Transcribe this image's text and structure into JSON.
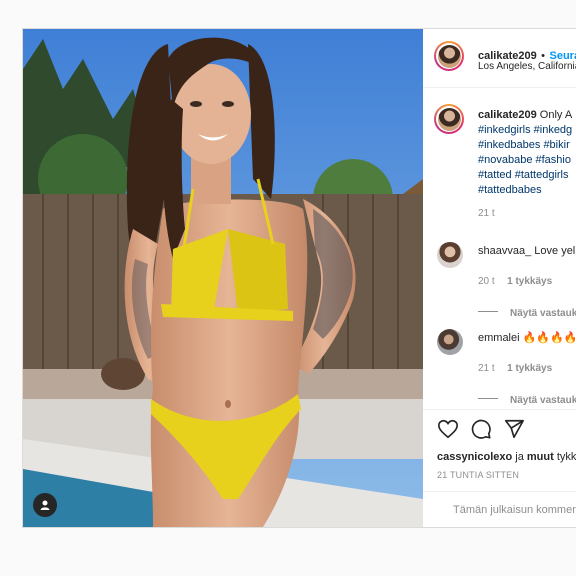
{
  "post": {
    "username": "calikate209",
    "separator": "•",
    "follow_label": "Seura",
    "location": "Los Angeles, California",
    "caption": {
      "username": "calikate209",
      "text": "Only A",
      "hashtags": [
        "#inkedgirls #inkedg",
        "#inkedbabes #bikir",
        "#novababe #fashio",
        "#tatted #tattedgirls",
        "#tattedbabes"
      ],
      "time": "21 t"
    },
    "comments": [
      {
        "username": "shaavvaa_",
        "text": "Love yel",
        "time": "20 t",
        "likes": "1 tykkäys",
        "view_replies": "Näytä vastauk"
      },
      {
        "username": "emmalei",
        "text": "🔥🔥🔥🔥",
        "time": "21 t",
        "likes": "1 tykkäys",
        "view_replies": "Näytä vastauk"
      }
    ],
    "liked_by": {
      "user": "cassynicolexo",
      "joiner": "ja",
      "others": "muut",
      "suffix": "tykk"
    },
    "timestamp": "21 TUNTIA SITTEN",
    "add_comment_placeholder": "Tämän julkaisun kommen"
  },
  "icons": {
    "heart": "heart-icon",
    "comment": "comment-icon",
    "share": "share-icon",
    "user_tag": "user-tag-icon"
  },
  "colors": {
    "link_blue": "#0095f6",
    "hashtag": "#00376b",
    "muted": "#8e8e8e",
    "bikini_yellow": "#e8d11c"
  }
}
